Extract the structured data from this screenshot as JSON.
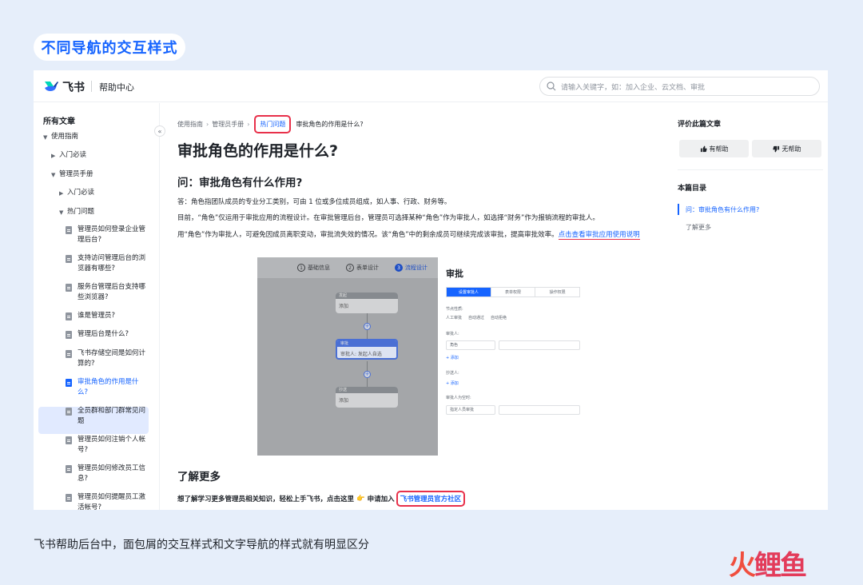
{
  "page_title": "不同导航的交互样式",
  "caption": "飞书帮助后台中，面包屑的交互样式和文字导航的样式就有明显区分",
  "watermark": "火鲤鱼",
  "header": {
    "logo_text": "飞书",
    "help_center": "帮助中心",
    "search_placeholder": "请输入关键字，如：加入企业、云文档、审批"
  },
  "sidebar": {
    "heading": "所有文章",
    "usage_guide": "使用指南",
    "intro_1": "入门必读",
    "admin_manual": "管理员手册",
    "intro_2": "入门必读",
    "hot_issues": "热门问题",
    "docs": [
      "管理员如何登录企业管理后台?",
      "支持访问管理后台的浏览器有哪些?",
      "服务台管理后台支持哪些浏览器?",
      "谁是管理员?",
      "管理后台是什么?",
      "飞书存储空间是如何计算的?",
      "审批角色的作用是什么?",
      "全员群和部门群常见问题",
      "管理员如何注销个人帐号?",
      "管理员如何修改员工信息?",
      "管理员如何提醒员工激活帐号?"
    ]
  },
  "breadcrumb": {
    "items": [
      "使用指南",
      "管理员手册"
    ],
    "hot": "热门问题",
    "current": "审批角色的作用是什么?"
  },
  "article": {
    "title": "审批角色的作用是什么?",
    "q_heading": "问：审批角色有什么作用?",
    "p1": "答：角色指团队成员的专业分工类别，可由 1 位或多位成员组成，如人事、行政、财务等。",
    "p2": "目前，“角色”仅运用于审批应用的流程设计。在审批管理后台，管理员可选择某种“角色”作为审批人，如选择“财务”作为报销流程的审批人。",
    "p3": "用“角色”作为审批人，可避免因成员离职变动，审批流失效的情况。该“角色”中的剩余成员可继续完成该审批，提高审批效率。",
    "p3_link": "点击查看审批应用使用说明",
    "more_heading": "了解更多",
    "more_text": "想了解学习更多管理员相关知识，轻松上手飞书，点击这里",
    "more_emoji": "👉",
    "more_join": "申请加入",
    "community_link": "飞书管理员官方社区"
  },
  "embedded": {
    "steps": [
      "基础信息",
      "表单设计",
      "流程设计"
    ],
    "step_nums": [
      "1",
      "2",
      "3"
    ],
    "node1_head": "发起",
    "node1_body": "添加",
    "node2_head": "审批",
    "node2_body": "审批人: 发起人自选",
    "node3_head": "抄送",
    "node3_body": "添加",
    "plus": "+",
    "panel_title": "审批",
    "tabs": [
      "设置审批人",
      "表单权限",
      "操作权限"
    ],
    "node_type_label": "节点性质:",
    "radios": [
      "人工审批",
      "自动通过",
      "自动拒绝"
    ],
    "approver_label": "审批人:",
    "role_value": "角色",
    "add1": "+ 添加",
    "cc_label": "抄送人:",
    "add2": "+ 添加",
    "empty_label": "审批人为空时:",
    "empty_value": "指定人员审批"
  },
  "right_panel": {
    "rate_title": "评价此篇文章",
    "helpful": "有帮助",
    "not_helpful": "无帮助",
    "toc_title": "本篇目录",
    "toc": [
      "问：审批角色有什么作用?",
      "了解更多"
    ]
  },
  "colors": {
    "brand_blue": "#1664ff",
    "highlight_red": "#e8304a",
    "background": "#e6eefa"
  }
}
